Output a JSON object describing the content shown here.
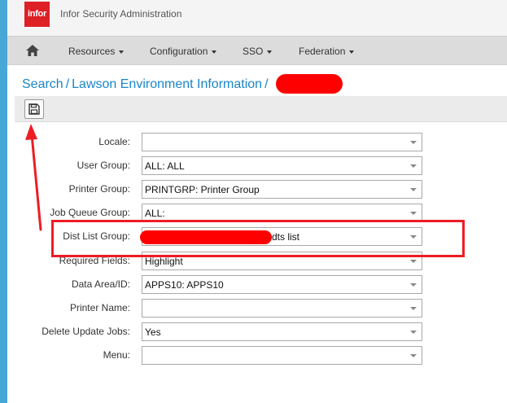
{
  "app": {
    "logo_text": "infor",
    "title": "Infor Security Administration"
  },
  "nav": {
    "items": [
      {
        "label": "Resources"
      },
      {
        "label": "Configuration"
      },
      {
        "label": "SSO"
      },
      {
        "label": "Federation"
      }
    ]
  },
  "breadcrumb": {
    "search": "Search",
    "env": "Lawson Environment Information",
    "sep": "/"
  },
  "form": {
    "locale": {
      "label": "Locale:",
      "value": ""
    },
    "user_group": {
      "label": "User Group:",
      "value": "ALL: ALL"
    },
    "printer_group": {
      "label": "Printer Group:",
      "value": "PRINTGRP: Printer Group"
    },
    "job_queue_group": {
      "label": "Job Queue Group:",
      "value": "ALL:"
    },
    "dist_list_group": {
      "label": "Dist List Group:",
      "value": "dts list"
    },
    "required_fields": {
      "label": "Required Fields:",
      "value": "Highlight"
    },
    "data_area": {
      "label": "Data Area/ID:",
      "value": "APPS10: APPS10"
    },
    "printer_name": {
      "label": "Printer Name:",
      "value": ""
    },
    "delete_update_jobs": {
      "label": "Delete Update Jobs:",
      "value": "Yes"
    },
    "menu": {
      "label": "Menu:",
      "value": ""
    }
  },
  "colors": {
    "accent": "#1a85c8",
    "brand": "#dd1f26",
    "annotation": "#ee1c24",
    "stripe": "#45a8d6"
  }
}
